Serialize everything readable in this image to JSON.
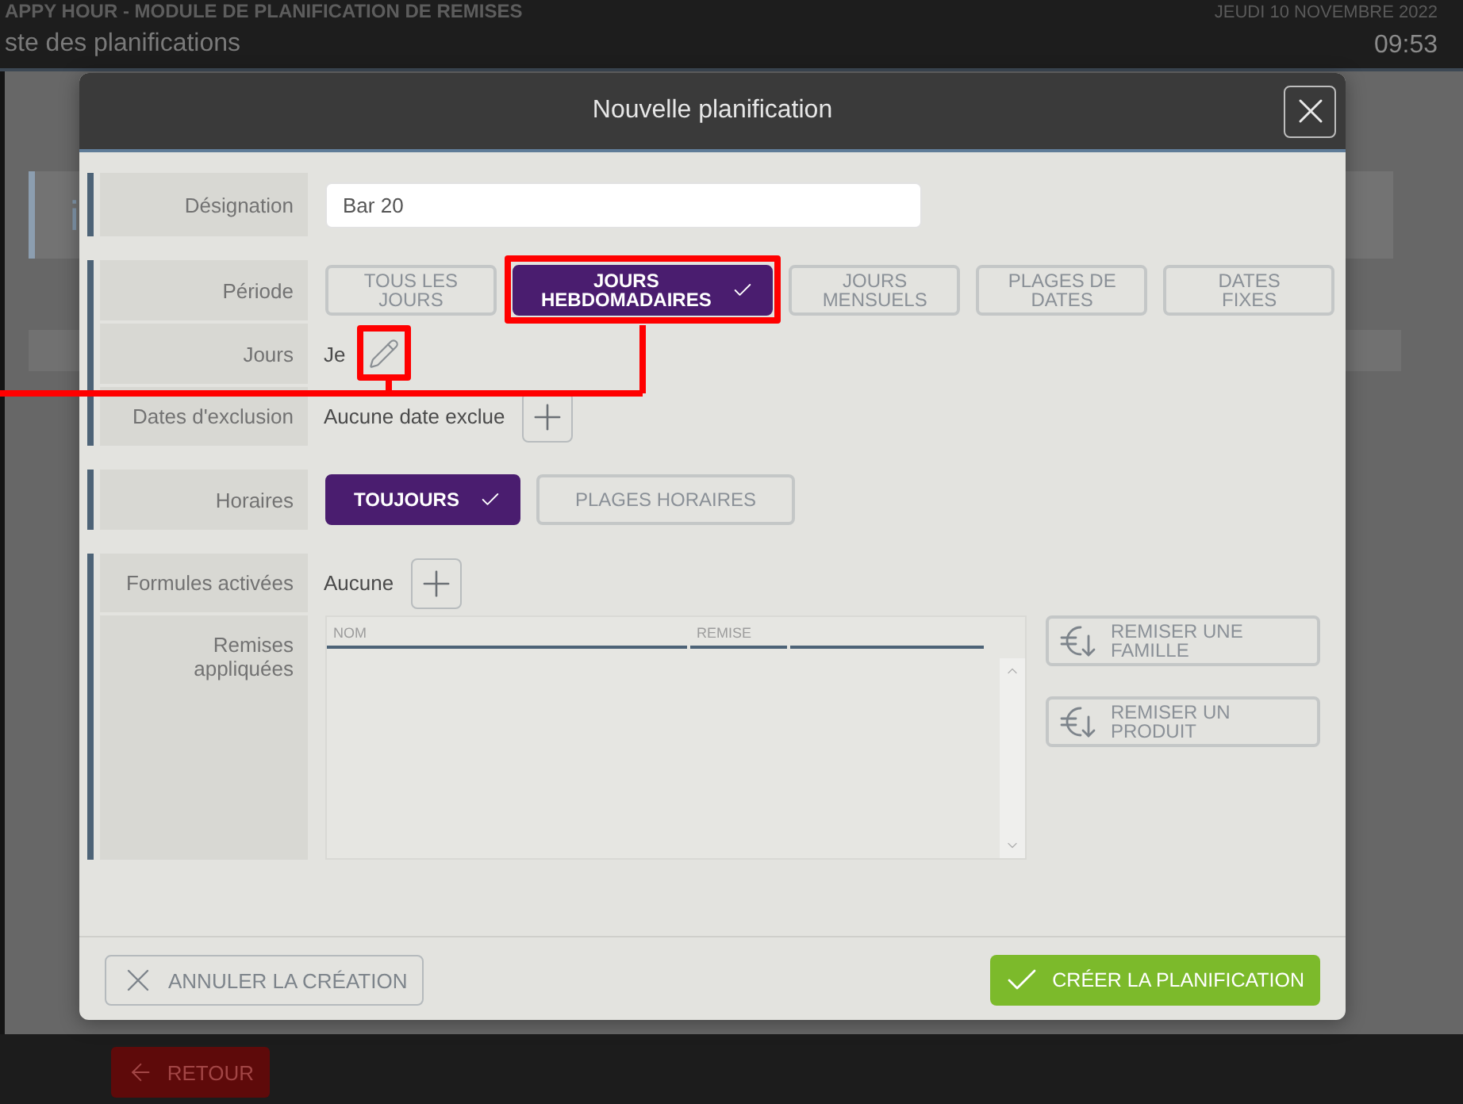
{
  "app_header": {
    "module_title": "APPY HOUR - MODULE DE PLANIFICATION DE REMISES",
    "page_title": "ste des planifications",
    "date": "JEUDI 10 NOVEMBRE 2022",
    "time": "09:53"
  },
  "background_card": {
    "text": "i"
  },
  "dialog": {
    "title": "Nouvelle planification",
    "groups": [
      {
        "rows": [
          {
            "kind": "field",
            "label": "Désignation",
            "value": "Bar 20"
          }
        ]
      },
      {
        "rows": [
          {
            "kind": "choices",
            "label": "Période",
            "options": [
              {
                "label": "TOUS LES JOURS",
                "selected": false,
                "highlighted": false
              },
              {
                "label": "JOURS HEBDOMADAIRES",
                "selected": true,
                "highlighted": true
              },
              {
                "label": "JOURS MENSUELS",
                "selected": false,
                "highlighted": false
              },
              {
                "label": "PLAGES DE DATES",
                "selected": false,
                "highlighted": false
              },
              {
                "label": "DATES FIXES",
                "selected": false,
                "highlighted": false
              }
            ]
          },
          {
            "kind": "edit",
            "label": "Jours",
            "value": "Je",
            "highlighted": true
          },
          {
            "kind": "add",
            "label": "Dates d'exclusion",
            "value": "Aucune date exclue"
          }
        ]
      },
      {
        "rows": [
          {
            "kind": "choices",
            "label": "Horaires",
            "options": [
              {
                "label": "TOUJOURS",
                "selected": true,
                "highlighted": false
              },
              {
                "label": "PLAGES HORAIRES",
                "selected": false,
                "highlighted": false
              }
            ]
          }
        ]
      },
      {
        "rows": [
          {
            "kind": "add",
            "label": "Formules activées",
            "value": "Aucune"
          },
          {
            "kind": "table",
            "label": "Remises appliquées",
            "columns": [
              "NOM",
              "REMISE"
            ],
            "actions": [
              "REMISER UNE FAMILLE",
              "REMISER UN PRODUIT"
            ]
          }
        ]
      }
    ],
    "cancel_button": "ANNULER LA CRÉATION",
    "confirm_button": "CRÉER LA PLANIFICATION"
  },
  "bottom_bar": {
    "back_button": "RETOUR"
  }
}
